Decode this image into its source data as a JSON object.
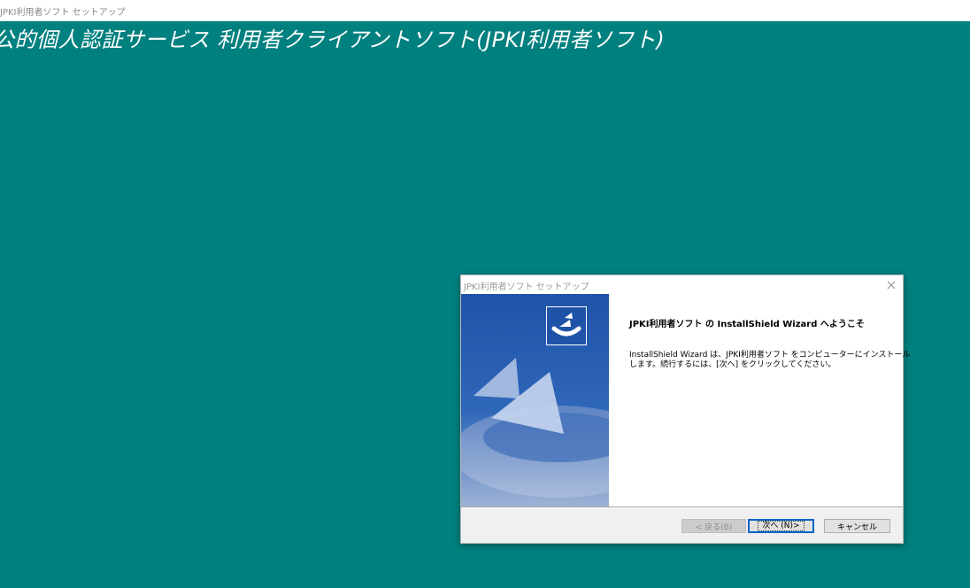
{
  "window": {
    "title": "JPKI利用者ソフト セットアップ"
  },
  "banner": {
    "text": "公的個人認証サービス 利用者クライアントソフト(JPKI利用者ソフト)"
  },
  "dialog": {
    "title": "JPKI利用者ソフト セットアップ",
    "heading": "JPKI利用者ソフト の InstallShield Wizard へようこそ",
    "body_line1": "InstallShield Wizard は、JPKI利用者ソフト をコンピューターにインストール",
    "body_line2": "します。続行するには、[次へ] をクリックしてください。",
    "buttons": {
      "back": "< 戻る(B)",
      "next": "次へ (N)>",
      "cancel": "キャンセル"
    }
  },
  "colors": {
    "desktop": "#00807f",
    "panel_blue": "#1f53a8",
    "focus": "#0a64c8"
  },
  "icons": {
    "close": "close-icon",
    "logo": "installshield-logo-icon"
  }
}
